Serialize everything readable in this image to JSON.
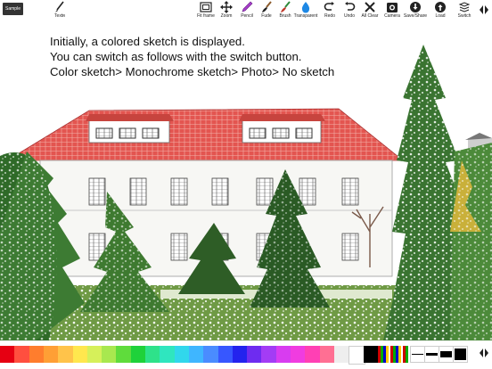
{
  "toolbar": {
    "sample_label": "Sample",
    "tools": [
      {
        "id": "textr",
        "label": "Textʀ",
        "icon": "brush-pen-icon"
      },
      {
        "id": "fit-frame",
        "label": "Fit frame",
        "icon": "frame-icon"
      },
      {
        "id": "zoom",
        "label": "Zoom",
        "icon": "move-arrows-icon"
      },
      {
        "id": "pencil",
        "label": "Pencil",
        "icon": "pencil-icon"
      },
      {
        "id": "fude",
        "label": "Fude",
        "icon": "fude-brush-icon"
      },
      {
        "id": "brush",
        "label": "Brush",
        "icon": "brush-icon"
      },
      {
        "id": "transparent",
        "label": "Transparent",
        "icon": "droplet-icon"
      },
      {
        "id": "redo",
        "label": "Redo",
        "icon": "redo-icon"
      },
      {
        "id": "undo",
        "label": "Undo",
        "icon": "undo-icon"
      },
      {
        "id": "all-clear",
        "label": "All Clear",
        "icon": "close-icon"
      },
      {
        "id": "camera",
        "label": "Camera",
        "icon": "camera-icon"
      },
      {
        "id": "save-share",
        "label": "Save/Share",
        "icon": "save-icon"
      },
      {
        "id": "load",
        "label": "Load",
        "icon": "load-icon"
      },
      {
        "id": "switch",
        "label": "Switch",
        "icon": "layers-icon"
      }
    ]
  },
  "caption": {
    "line1": "Initially, a colored sketch is displayed.",
    "line2": "You can switch as follows with the switch button.",
    "line3": "Color sketch> Monochrome sketch> Photo> No sketch"
  },
  "palette": {
    "colors": [
      "#e60012",
      "#ff4f3f",
      "#ff7d2d",
      "#ff9f35",
      "#ffc34a",
      "#ffe74e",
      "#d6f05a",
      "#a8e84f",
      "#5fdc3c",
      "#1fd23a",
      "#2ee28a",
      "#2fe6bf",
      "#31d7ec",
      "#3fb6ff",
      "#4a8cff",
      "#3757ff",
      "#2323ee",
      "#6e2cf0",
      "#a33cf5",
      "#d83cf0",
      "#f03ce0",
      "#ff40b4",
      "#ff6f93",
      "#eeeeee",
      "#ffffff",
      "#000000"
    ]
  }
}
